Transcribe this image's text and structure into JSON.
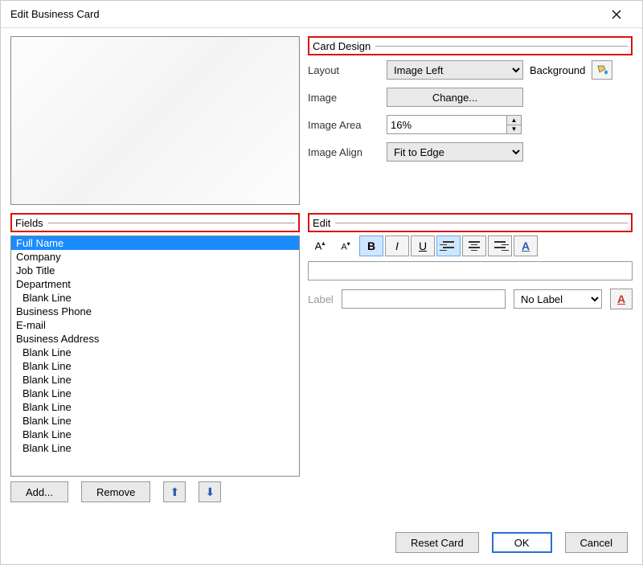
{
  "title": "Edit Business Card",
  "card_design": {
    "header": "Card Design",
    "labels": {
      "layout": "Layout",
      "background": "Background",
      "image": "Image",
      "image_area": "Image Area",
      "image_align": "Image Align"
    },
    "layout_value": "Image Left",
    "change_label": "Change...",
    "image_area_value": "16%",
    "image_align_value": "Fit to Edge"
  },
  "fields": {
    "header": "Fields",
    "items": [
      {
        "text": "Full Name",
        "selected": true,
        "indent": false
      },
      {
        "text": "Company",
        "selected": false,
        "indent": false
      },
      {
        "text": "Job Title",
        "selected": false,
        "indent": false
      },
      {
        "text": "Department",
        "selected": false,
        "indent": false
      },
      {
        "text": "Blank Line",
        "selected": false,
        "indent": true
      },
      {
        "text": "Business Phone",
        "selected": false,
        "indent": false
      },
      {
        "text": "E-mail",
        "selected": false,
        "indent": false
      },
      {
        "text": "Business Address",
        "selected": false,
        "indent": false
      },
      {
        "text": "Blank Line",
        "selected": false,
        "indent": true
      },
      {
        "text": "Blank Line",
        "selected": false,
        "indent": true
      },
      {
        "text": "Blank Line",
        "selected": false,
        "indent": true
      },
      {
        "text": "Blank Line",
        "selected": false,
        "indent": true
      },
      {
        "text": "Blank Line",
        "selected": false,
        "indent": true
      },
      {
        "text": "Blank Line",
        "selected": false,
        "indent": true
      },
      {
        "text": "Blank Line",
        "selected": false,
        "indent": true
      },
      {
        "text": "Blank Line",
        "selected": false,
        "indent": true
      }
    ],
    "add_label": "Add...",
    "remove_label": "Remove"
  },
  "edit": {
    "header": "Edit",
    "text_value": "",
    "label_label": "Label",
    "label_value": "",
    "label_select": "No Label"
  },
  "bottom": {
    "reset": "Reset Card",
    "ok": "OK",
    "cancel": "Cancel"
  }
}
